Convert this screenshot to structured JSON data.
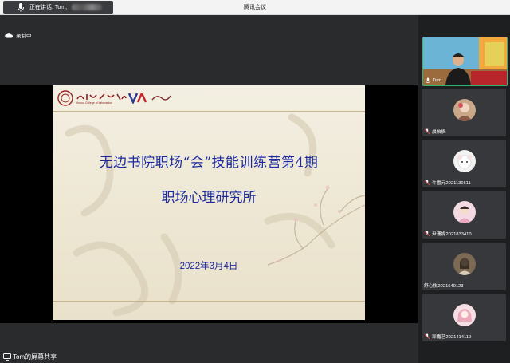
{
  "app": {
    "title": "腾讯会议"
  },
  "speaking": {
    "label": "正在讲话: Tom;"
  },
  "recording": {
    "label": "录制中"
  },
  "slide": {
    "title_line1": "无边书院职场“会”技能训练营第4期",
    "title_line2": "职场心理研究所",
    "date": "2022年3月4日",
    "logo_sub": "Xinhua College of Information"
  },
  "participants": [
    {
      "name": "Tom",
      "video": true
    },
    {
      "name": "晨帕枫",
      "video": false
    },
    {
      "name": "许雪元2021136611",
      "video": false
    },
    {
      "name": "尹珊妮2021833410",
      "video": false
    },
    {
      "name": "舒心悦2021649123",
      "video": false
    },
    {
      "name": "郭嘉艺2021414119",
      "video": false
    }
  ],
  "screen_share": {
    "label": "Tom的屏幕共享"
  },
  "colors": {
    "slide_text": "#1d2aa0",
    "active_border": "#33b36b"
  }
}
